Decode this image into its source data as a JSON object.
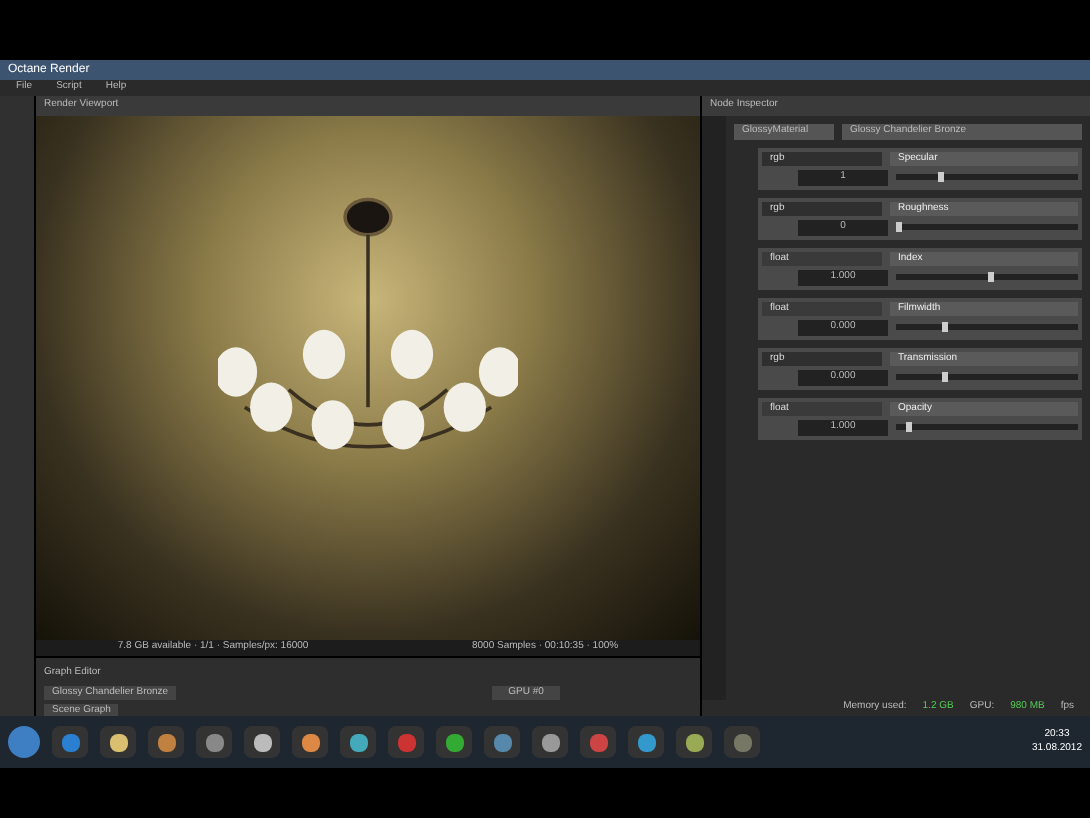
{
  "window": {
    "title": "Octane Render"
  },
  "menu": [
    "File",
    "Script",
    "Help"
  ],
  "viewport": {
    "title": "Render Viewport",
    "stats_left": "7.8 GB available · 1/1 · Samples/px: 16000",
    "stats_right": "8000 Samples · 00:10:35 · 100%"
  },
  "inspector": {
    "title": "Node Inspector",
    "node_type": "GlossyMaterial",
    "node_name": "Glossy Chandelier Bronze",
    "params": [
      {
        "type": "rgb",
        "name": "Specular",
        "value": "1",
        "level": 0.23
      },
      {
        "type": "rgb",
        "name": "Roughness",
        "value": "0",
        "level": 0.0
      },
      {
        "type": "float",
        "name": "Index",
        "value": "1.000",
        "level": 0.5
      },
      {
        "type": "float",
        "name": "Filmwidth",
        "value": "0.000",
        "level": 0.25
      },
      {
        "type": "rgb",
        "name": "Transmission",
        "value": "0.000",
        "level": 0.25
      },
      {
        "type": "float",
        "name": "Opacity",
        "value": "1.000",
        "level": 0.05
      }
    ]
  },
  "graph_editor": {
    "title": "Graph Editor",
    "node": "Glossy Chandelier Bronze",
    "value": "GPU #0",
    "tab": "Scene Graph"
  },
  "status": {
    "label_1": "Memory used:",
    "value_1": "1.2 GB",
    "label_2": "GPU:",
    "value_2": "980 MB",
    "label_3": "fps"
  },
  "clock": {
    "time": "20:33",
    "date": "31.08.2012"
  }
}
